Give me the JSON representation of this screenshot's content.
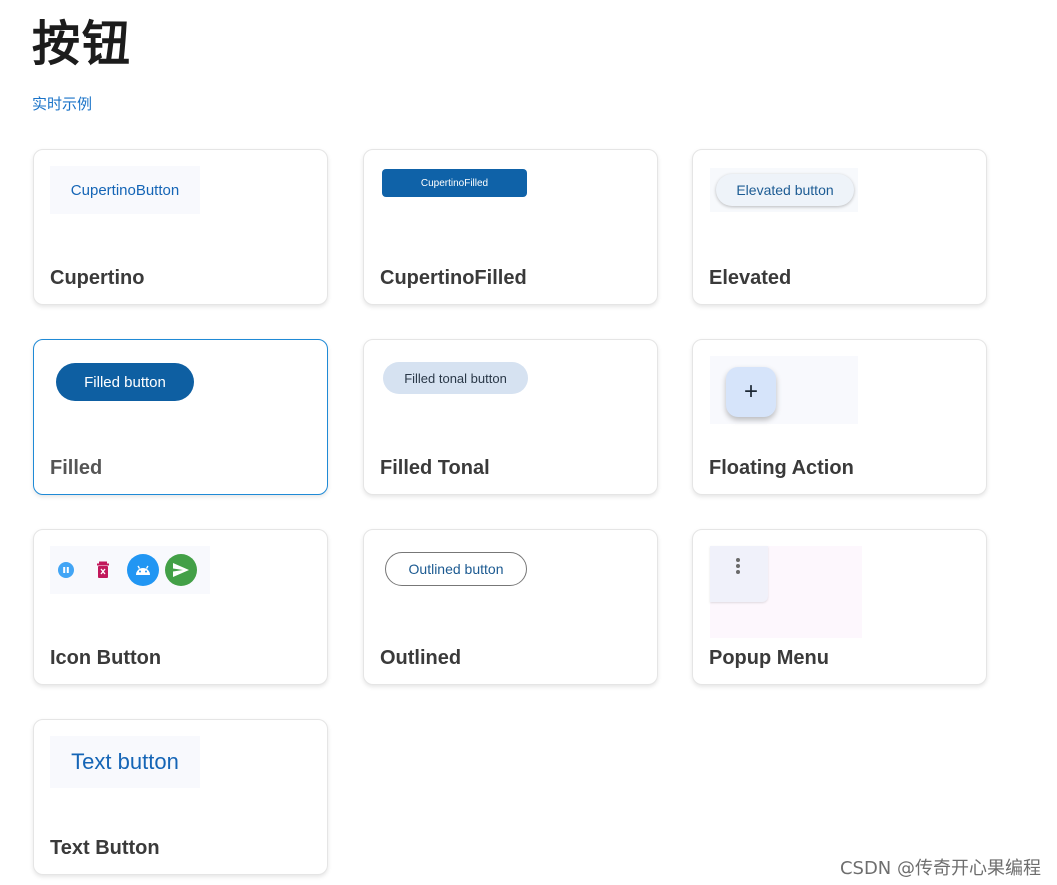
{
  "page": {
    "title": "按钮",
    "live_example_link": "实时示例"
  },
  "cards": {
    "cupertino": {
      "title": "Cupertino",
      "button_label": "CupertinoButton"
    },
    "cupertino_filled": {
      "title": "CupertinoFilled",
      "button_label": "CupertinoFilled"
    },
    "elevated": {
      "title": "Elevated",
      "button_label": "Elevated button"
    },
    "filled": {
      "title": "Filled",
      "button_label": "Filled button"
    },
    "filled_tonal": {
      "title": "Filled Tonal",
      "button_label": "Filled tonal button"
    },
    "floating_action": {
      "title": "Floating Action",
      "button_label": "+"
    },
    "icon_button": {
      "title": "Icon Button",
      "icons": [
        "pause-icon",
        "delete-icon",
        "android-icon",
        "send-icon"
      ]
    },
    "outlined": {
      "title": "Outlined",
      "button_label": "Outlined button"
    },
    "popup_menu": {
      "title": "Popup Menu",
      "icon": "more-vert-icon"
    },
    "text_button": {
      "title": "Text Button",
      "button_label": "Text button"
    }
  },
  "colors": {
    "primary": "#0e5fa2",
    "link": "#1a73c8",
    "selected_border": "#1f8ad6",
    "tonal": "#d6e2f1",
    "fab": "#d6e4fa",
    "icon_blue": "#2196f3",
    "icon_green": "#43a047",
    "icon_delete": "#c2185b"
  },
  "watermark": "CSDN @传奇开心果编程"
}
